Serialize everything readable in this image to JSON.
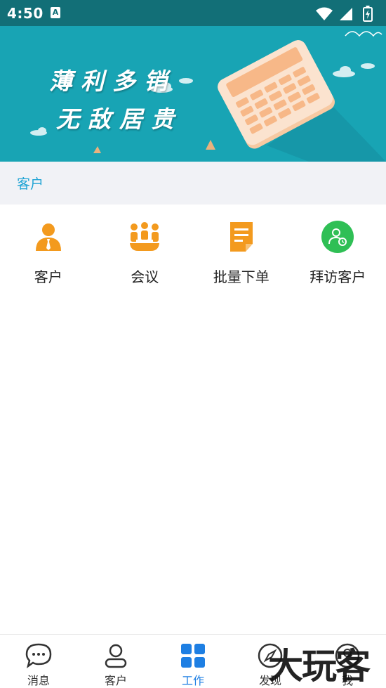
{
  "status_bar": {
    "time": "4:50",
    "notification_icon": "A"
  },
  "banner": {
    "line1": "薄利多销",
    "line2": "无敌居贵",
    "illustration": "calculator-illustration"
  },
  "section": {
    "title": "客户"
  },
  "functions": [
    {
      "label": "客户",
      "icon": "customer-icon",
      "color": "#f39a1e"
    },
    {
      "label": "会议",
      "icon": "meeting-icon",
      "color": "#f39a1e"
    },
    {
      "label": "批量下单",
      "icon": "bulk-order-icon",
      "color": "#f39a1e"
    },
    {
      "label": "拜访客户",
      "icon": "visit-customer-icon",
      "color": "#2fbf55"
    }
  ],
  "bottom_nav": {
    "active": "工作",
    "active_color": "#1e7fe3",
    "items": [
      {
        "label": "消息",
        "icon": "message-icon"
      },
      {
        "label": "客户",
        "icon": "person-icon"
      },
      {
        "label": "工作",
        "icon": "grid-icon"
      },
      {
        "label": "发现",
        "icon": "compass-icon"
      },
      {
        "label": "我",
        "icon": "profile-icon"
      }
    ]
  },
  "watermark": {
    "text": "大玩客"
  }
}
